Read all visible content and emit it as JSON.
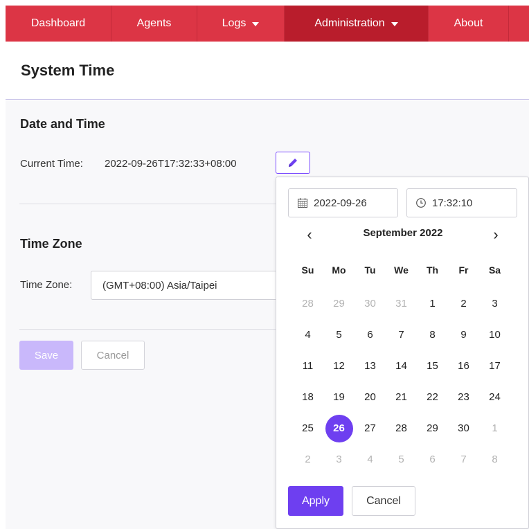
{
  "navbar": {
    "items": [
      {
        "label": "Dashboard",
        "dropdown": false,
        "active": false
      },
      {
        "label": "Agents",
        "dropdown": false,
        "active": false
      },
      {
        "label": "Logs",
        "dropdown": true,
        "active": false
      },
      {
        "label": "Administration",
        "dropdown": true,
        "active": true
      },
      {
        "label": "About",
        "dropdown": false,
        "active": false
      }
    ],
    "color": "#dc3545",
    "active_color": "#b91d2c"
  },
  "page": {
    "title": "System Time"
  },
  "date_time": {
    "section_title": "Date and Time",
    "current_time_label": "Current Time:",
    "current_time_value": "2022-09-26T17:32:33+08:00",
    "edit_icon": "pencil-icon"
  },
  "time_zone": {
    "section_title": "Time Zone",
    "label": "Time Zone:",
    "selected": "(GMT+08:00) Asia/Taipei"
  },
  "actions": {
    "save_label": "Save",
    "cancel_label": "Cancel"
  },
  "picker": {
    "date_value": "2022-09-26",
    "time_value": "17:32:10",
    "date_icon": "calendar-icon",
    "time_icon": "clock-icon",
    "prev": "‹",
    "next": "›",
    "month_title": "September 2022",
    "weekdays": [
      "Su",
      "Mo",
      "Tu",
      "We",
      "Th",
      "Fr",
      "Sa"
    ],
    "weeks": [
      [
        {
          "d": "28",
          "out": true
        },
        {
          "d": "29",
          "out": true
        },
        {
          "d": "30",
          "out": true
        },
        {
          "d": "31",
          "out": true
        },
        {
          "d": "1"
        },
        {
          "d": "2"
        },
        {
          "d": "3"
        }
      ],
      [
        {
          "d": "4"
        },
        {
          "d": "5"
        },
        {
          "d": "6"
        },
        {
          "d": "7"
        },
        {
          "d": "8"
        },
        {
          "d": "9"
        },
        {
          "d": "10"
        }
      ],
      [
        {
          "d": "11"
        },
        {
          "d": "12"
        },
        {
          "d": "13"
        },
        {
          "d": "14"
        },
        {
          "d": "15"
        },
        {
          "d": "16"
        },
        {
          "d": "17"
        }
      ],
      [
        {
          "d": "18"
        },
        {
          "d": "19"
        },
        {
          "d": "20"
        },
        {
          "d": "21"
        },
        {
          "d": "22"
        },
        {
          "d": "23"
        },
        {
          "d": "24"
        }
      ],
      [
        {
          "d": "25"
        },
        {
          "d": "26",
          "selected": true
        },
        {
          "d": "27"
        },
        {
          "d": "28"
        },
        {
          "d": "29"
        },
        {
          "d": "30"
        },
        {
          "d": "1",
          "out": true
        }
      ],
      [
        {
          "d": "2",
          "out": true
        },
        {
          "d": "3",
          "out": true
        },
        {
          "d": "4",
          "out": true
        },
        {
          "d": "5",
          "out": true
        },
        {
          "d": "6",
          "out": true
        },
        {
          "d": "7",
          "out": true
        },
        {
          "d": "8",
          "out": true
        }
      ]
    ],
    "apply_label": "Apply",
    "cancel_label": "Cancel",
    "accent": "#6e3ff0"
  }
}
